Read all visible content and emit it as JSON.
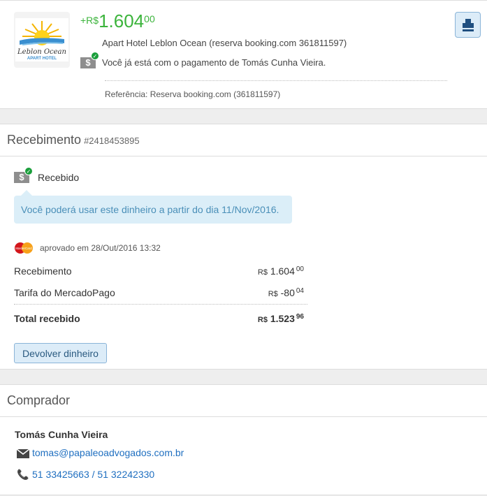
{
  "summary": {
    "currency": "+R$",
    "amount": "1.604",
    "cents": "00",
    "description": "Apart Hotel Leblon Ocean (reserva booking.com 361811597)",
    "status": "Você já está com o pagamento de Tomás Cunha Vieira.",
    "reference": "Referência: Reserva booking.com (361811597)",
    "logo_text": [
      "Leblon Ocean",
      "APART HOTEL"
    ]
  },
  "receipt": {
    "title": "Recebimento",
    "id": "#2418453895",
    "status": "Recebido",
    "notice": "Você poderá usar este dinheiro a partir do dia 11/Nov/2016.",
    "approved": "aprovado em 28/Out/2016 13:32",
    "card_brand": "MasterCard",
    "rows": [
      {
        "label": "Recebimento",
        "cur": "R$",
        "amount": "1.604",
        "cents": "00"
      },
      {
        "label": "Tarifa do MercadoPago",
        "cur": "R$",
        "amount": "-80",
        "cents": "04"
      }
    ],
    "total": {
      "label": "Total recebido",
      "cur": "R$",
      "amount": "1.523",
      "cents": "96"
    },
    "refund_button": "Devolver dinheiro"
  },
  "buyer": {
    "title": "Comprador",
    "name": "Tomás Cunha Vieira",
    "email": "tomas@papaleoadvogados.com.br",
    "phone": "51 33425663 / 51 32242330"
  }
}
